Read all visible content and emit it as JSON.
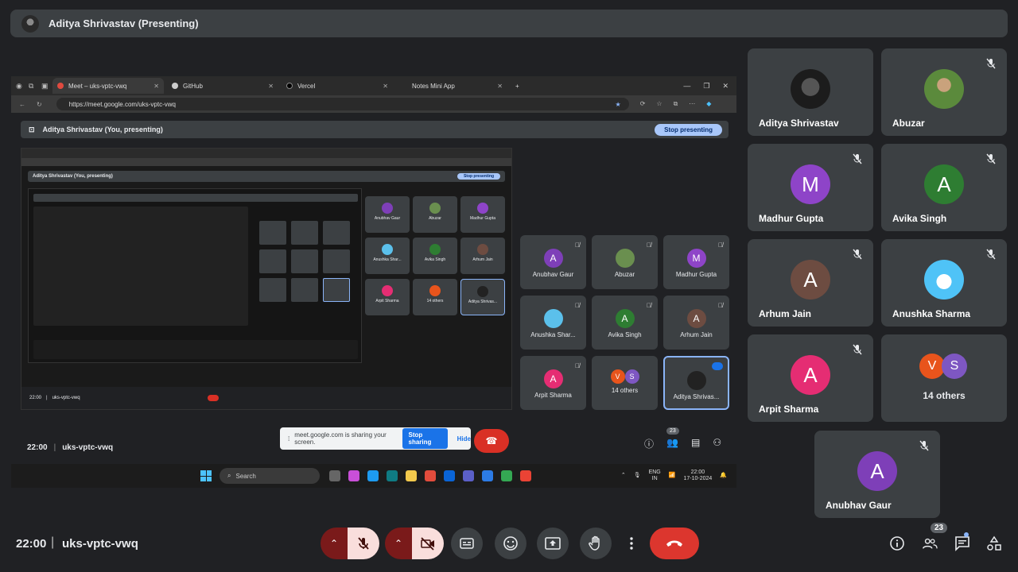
{
  "presenter_banner": {
    "text": "Aditya Shrivastav (Presenting)"
  },
  "shared_screen": {
    "tabs": [
      {
        "label": "Meet – uks-vptc-vwq"
      },
      {
        "label": "GitHub"
      },
      {
        "label": "Vercel"
      },
      {
        "label": "Notes Mini App"
      }
    ],
    "url": "https://meet.google.com/uks-vptc-vwq",
    "inner_banner_text": "Aditya Shrivastav (You, presenting)",
    "stop_presenting_label": "Stop presenting",
    "nested_banner_text": "Aditya Shrivastav (You, presenting)",
    "nested_stop_label": "Stop presenting",
    "nested_time": "22:00",
    "nested_code": "uks-vptc-vwq",
    "tiles": [
      {
        "name": "Anubhav Gaur",
        "initial": "A",
        "color": "#7e3fb8"
      },
      {
        "name": "Abuzar",
        "initial": "",
        "color": "#6a8f4f"
      },
      {
        "name": "Madhur Gupta",
        "initial": "M",
        "color": "#8e44c8"
      },
      {
        "name": "Anushka Shar...",
        "initial": "",
        "color": "#5bc0eb"
      },
      {
        "name": "Avika Singh",
        "initial": "A",
        "color": "#2e7d32"
      },
      {
        "name": "Arhum Jain",
        "initial": "A",
        "color": "#6d4c41"
      },
      {
        "name": "Arpit Sharma",
        "initial": "A",
        "color": "#e52d73"
      },
      {
        "name": "14 others",
        "initial": "",
        "color": "#3c4043"
      },
      {
        "name": "Aditya Shrivas...",
        "initial": "",
        "color": "#333"
      }
    ],
    "others_initials": [
      "V",
      "S"
    ],
    "time": "22:00",
    "meeting_code": "uks-vptc-vwq",
    "share_notice": "meet.google.com is sharing your screen.",
    "stop_sharing_label": "Stop sharing",
    "hide_label": "Hide",
    "people_count": "23",
    "os_search": "Search",
    "tray_lang": "ENG",
    "tray_region": "IN",
    "tray_time": "22:00",
    "tray_date": "17-10-2024"
  },
  "participants": [
    {
      "name": "Aditya Shrivastav",
      "initial": "",
      "color": "#222",
      "muted": false
    },
    {
      "name": "Abuzar",
      "initial": "",
      "color": "#6a8f4f",
      "muted": true
    },
    {
      "name": "Madhur Gupta",
      "initial": "M",
      "color": "#8e44c8",
      "muted": true
    },
    {
      "name": "Avika Singh",
      "initial": "A",
      "color": "#2e7d32",
      "muted": true
    },
    {
      "name": "Arhum Jain",
      "initial": "A",
      "color": "#6d4c41",
      "muted": true
    },
    {
      "name": "Anushka Sharma",
      "initial": "",
      "color": "#5bc0eb",
      "muted": true
    },
    {
      "name": "Arpit Sharma",
      "initial": "A",
      "color": "#e52d73",
      "muted": true
    },
    {
      "name": "14 others",
      "initial": "",
      "color": "#3c4043",
      "muted": false
    },
    {
      "name": "Anubhav Gaur",
      "initial": "A",
      "color": "#7e3fb8",
      "muted": true
    }
  ],
  "others_initials": [
    {
      "letter": "V",
      "color": "#e8541c"
    },
    {
      "letter": "S",
      "color": "#7e57c2"
    }
  ],
  "bottom_bar": {
    "time": "22:00",
    "separator": "|",
    "meeting_code": "uks-vptc-vwq",
    "people_count": "23"
  },
  "colors": {
    "background": "#202124",
    "tile": "#3c4043",
    "end_call": "#dc362e",
    "muted_bg": "#f9dedc",
    "chevron_bg": "#7a1a1a"
  }
}
